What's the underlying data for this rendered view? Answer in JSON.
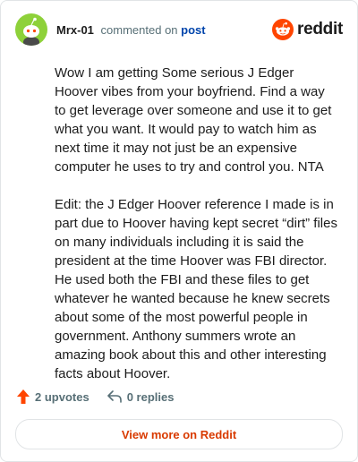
{
  "header": {
    "username": "Mrx-01",
    "action_text": "commented on",
    "post_link": "post",
    "brand": "reddit"
  },
  "comment": {
    "paragraphs": [
      "Wow I am getting Some serious J Edger Hoover vibes from your boyfriend. Find a way to get leverage over someone and use it to get what you want. It would pay to watch him as next time it may not just be an expensive computer he uses to try and control you. NTA",
      "Edit: the J Edger Hoover reference I made is in part due to Hoover having kept secret “dirt” files on many individuals including it is said the president at the time Hoover was FBI director. He used both the FBI and these files to get whatever he wanted because he knew secrets about some of the most powerful people in government. Anthony summers wrote an amazing book about this and other interesting facts about Hoover."
    ]
  },
  "actions": {
    "upvotes": "2 upvotes",
    "replies": "0 replies"
  },
  "footer": {
    "view_more": "View more on Reddit"
  },
  "colors": {
    "accent": "#d93a00",
    "brand_orange": "#ff4500",
    "avatar_bg": "#8ed13a",
    "link_blue": "#0045ac"
  },
  "icons": {
    "avatar": "snoo-avatar-icon",
    "brand": "reddit-logo-icon",
    "upvote": "upvote-arrow-icon",
    "reply": "reply-arrow-icon"
  }
}
